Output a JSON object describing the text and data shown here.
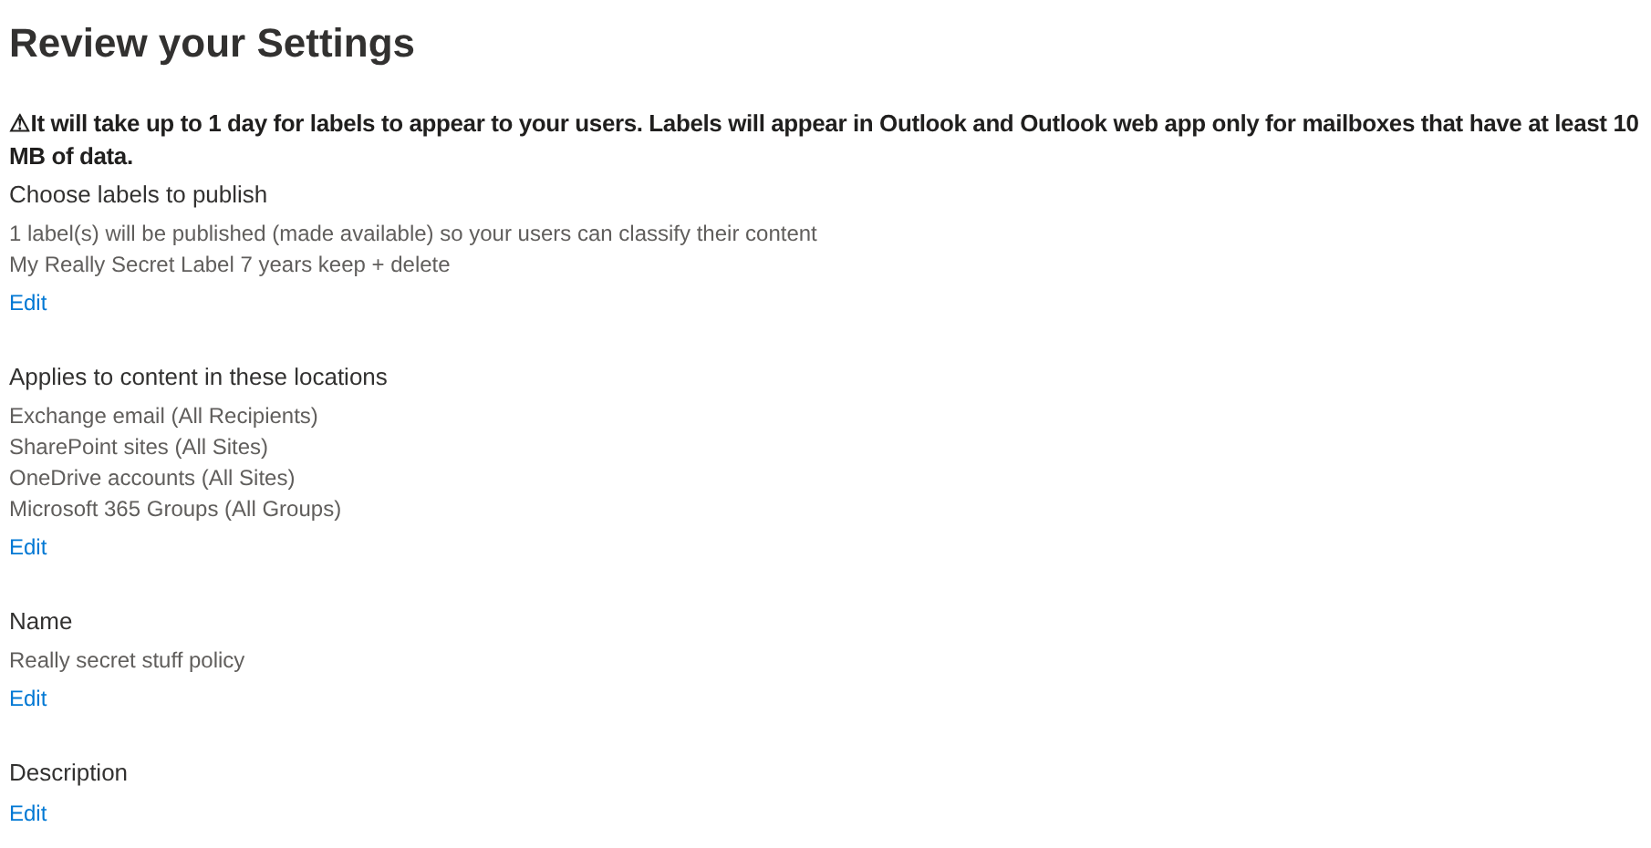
{
  "title": "Review your Settings",
  "warning": "⚠It will take up to 1 day for labels to appear to your users. Labels will appear in Outlook and Outlook web app only for mailboxes that have at least 10 MB of data.",
  "sections": [
    {
      "heading": "Choose labels to publish",
      "lines": [
        "1 label(s) will be published (made available) so your users can classify their content",
        "My Really Secret Label 7 years keep + delete"
      ],
      "link": "Edit"
    },
    {
      "heading": "Applies to content in these locations",
      "lines": [
        "Exchange email (All Recipients)",
        "SharePoint sites (All Sites)",
        "OneDrive accounts (All Sites)",
        "Microsoft 365 Groups (All Groups)"
      ],
      "link": "Edit"
    },
    {
      "heading": "Name",
      "lines": [
        "Really secret stuff policy"
      ],
      "link": "Edit"
    },
    {
      "heading": "Description",
      "link": "Edit"
    }
  ]
}
